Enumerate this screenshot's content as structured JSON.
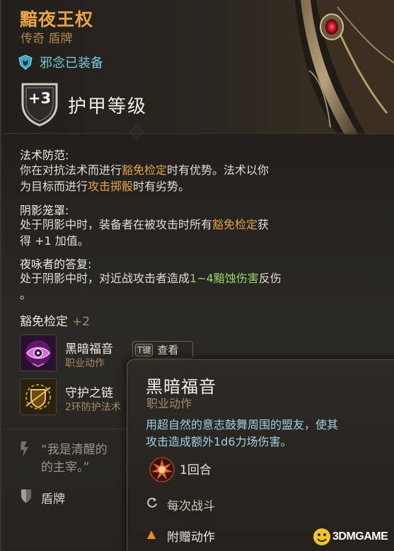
{
  "item": {
    "name": "黯夜王权",
    "subtitle": "传奇 盾牌",
    "equipped_status": "邪念已装备",
    "armor_bonus": "+3",
    "armor_label": "护甲等级"
  },
  "passives": [
    {
      "title": "法术防范:",
      "line1_a": "你在对抗法术而进行",
      "line1_hl": "豁免检定",
      "line1_b": "时有优势。法术以你",
      "line2_a": "为目标而进行",
      "line2_hl": "攻击掷骰",
      "line2_b": "时有劣势。"
    },
    {
      "title": "阴影笼罩:",
      "line1_a": "处于阴影中时，装备者在被攻击时所有",
      "line1_hl": "豁免检定",
      "line1_b": "获",
      "line2": "得 +1 加值。"
    },
    {
      "title": "夜咏者的答复:",
      "line1_a": "处于阴影中时，对近战攻击者造成",
      "line1_hl": "1~4黯蚀伤害",
      "line1_b": "反伤",
      "line2": "。"
    }
  ],
  "saves": {
    "label": "豁免检定",
    "value": "+2"
  },
  "spells": [
    {
      "name": "黑暗福音",
      "type": "职业动作"
    },
    {
      "name": "守护之链",
      "type": "2环防护法术"
    }
  ],
  "inspect": {
    "key": "T键",
    "label": "查看"
  },
  "quote": {
    "line1": "“我是清醒的",
    "line2": "的主宰。”"
  },
  "footer": {
    "category": "盾牌"
  },
  "tooltip": {
    "title": "黑暗福音",
    "type": "职业动作",
    "desc_line1": "用超自然的意志鼓舞周围的盟友，使其",
    "desc_line2": "攻击造成额外1d6力场伤害。",
    "duration": "1回合",
    "recharge": "每次战斗",
    "cost": "附赠动作"
  },
  "watermark": {
    "text": "3DMGAME"
  },
  "colors": {
    "title_gold": "#e9a349",
    "highlight_gold": "#e0a34f",
    "highlight_green": "#98d36a",
    "equipped_cyan": "#78c8d8",
    "tooltip_desc": "#9fd0e0"
  },
  "icons": {
    "equipped": "shield-mask-icon",
    "armor": "armor-shield-icon",
    "spell_1": "dark-eye-icon",
    "spell_2": "guardian-chain-icon",
    "quote": "quote-mark-icon",
    "footer": "shield-category-icon",
    "duration": "sun-burst-icon",
    "recharge": "refresh-icon",
    "cost": "triangle-icon"
  }
}
